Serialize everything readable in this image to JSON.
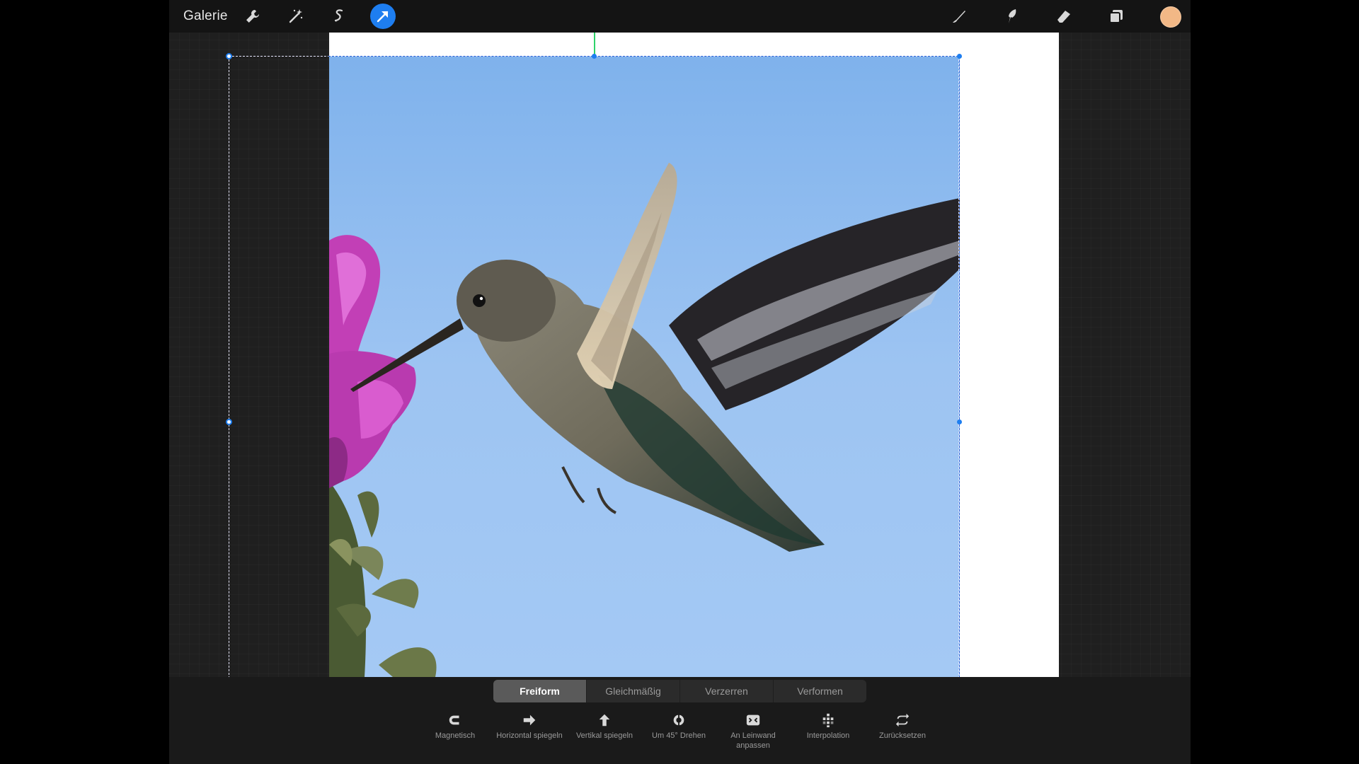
{
  "topbar": {
    "gallery_label": "Galerie",
    "tools_left": [
      "wrench-icon",
      "magic-wand-icon",
      "selection-icon",
      "transform-arrow-icon"
    ],
    "tools_right": [
      "brush-icon",
      "smudge-icon",
      "eraser-icon",
      "layers-icon"
    ],
    "current_color": "#f2b886",
    "accent": "#1e7ef0"
  },
  "transform": {
    "modes": [
      {
        "label": "Freiform",
        "active": true
      },
      {
        "label": "Gleichmäßig",
        "active": false
      },
      {
        "label": "Verzerren",
        "active": false
      },
      {
        "label": "Verformen",
        "active": false
      }
    ],
    "actions": [
      {
        "label": "Magnetisch",
        "icon": "magnet-icon"
      },
      {
        "label": "Horizontal spiegeln",
        "icon": "flip-horizontal-icon"
      },
      {
        "label": "Vertikal spiegeln",
        "icon": "flip-vertical-icon"
      },
      {
        "label": "Um 45° Drehen",
        "icon": "rotate-45-icon"
      },
      {
        "label": "An Leinwand anpassen",
        "icon": "fit-to-canvas-icon"
      },
      {
        "label": "Interpolation",
        "icon": "interpolation-icon"
      },
      {
        "label": "Zurücksetzen",
        "icon": "reset-icon"
      }
    ]
  }
}
